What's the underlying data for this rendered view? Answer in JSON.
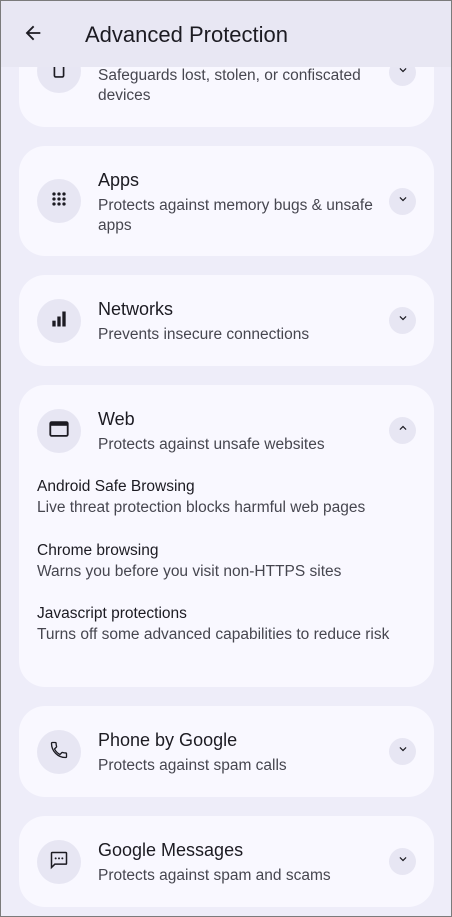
{
  "app_bar": {
    "title": "Advanced Protection",
    "back_icon": "arrow-back-icon"
  },
  "colors": {
    "background": "#eeedf9",
    "card": "#f9f8ff",
    "icon_circle": "#e7e6f3",
    "text_primary": "#1c1b22",
    "text_secondary": "#46464f"
  },
  "cards": {
    "device": {
      "icon": "phone-device-icon",
      "description": "Safeguards lost, stolen, or confiscated devices",
      "expanded": false
    },
    "apps": {
      "icon": "apps-grid-icon",
      "title": "Apps",
      "description": "Protects against memory bugs & unsafe apps",
      "expanded": false
    },
    "networks": {
      "icon": "signal-bars-icon",
      "title": "Networks",
      "description": "Prevents insecure connections",
      "expanded": false
    },
    "web": {
      "icon": "browser-window-icon",
      "title": "Web",
      "description": "Protects against unsafe websites",
      "expanded": true,
      "items": [
        {
          "title": "Android Safe Browsing",
          "description": "Live threat protection blocks harmful web pages"
        },
        {
          "title": "Chrome browsing",
          "description": "Warns you before you visit non-HTTPS sites"
        },
        {
          "title": "Javascript protections",
          "description": "Turns off some advanced capabilities to reduce risk"
        }
      ]
    },
    "phone": {
      "icon": "phone-handset-icon",
      "title": "Phone by Google",
      "description": "Protects against spam calls",
      "expanded": false
    },
    "messages": {
      "icon": "message-bubble-icon",
      "title": "Google Messages",
      "description": "Protects against spam and scams",
      "expanded": false
    }
  }
}
